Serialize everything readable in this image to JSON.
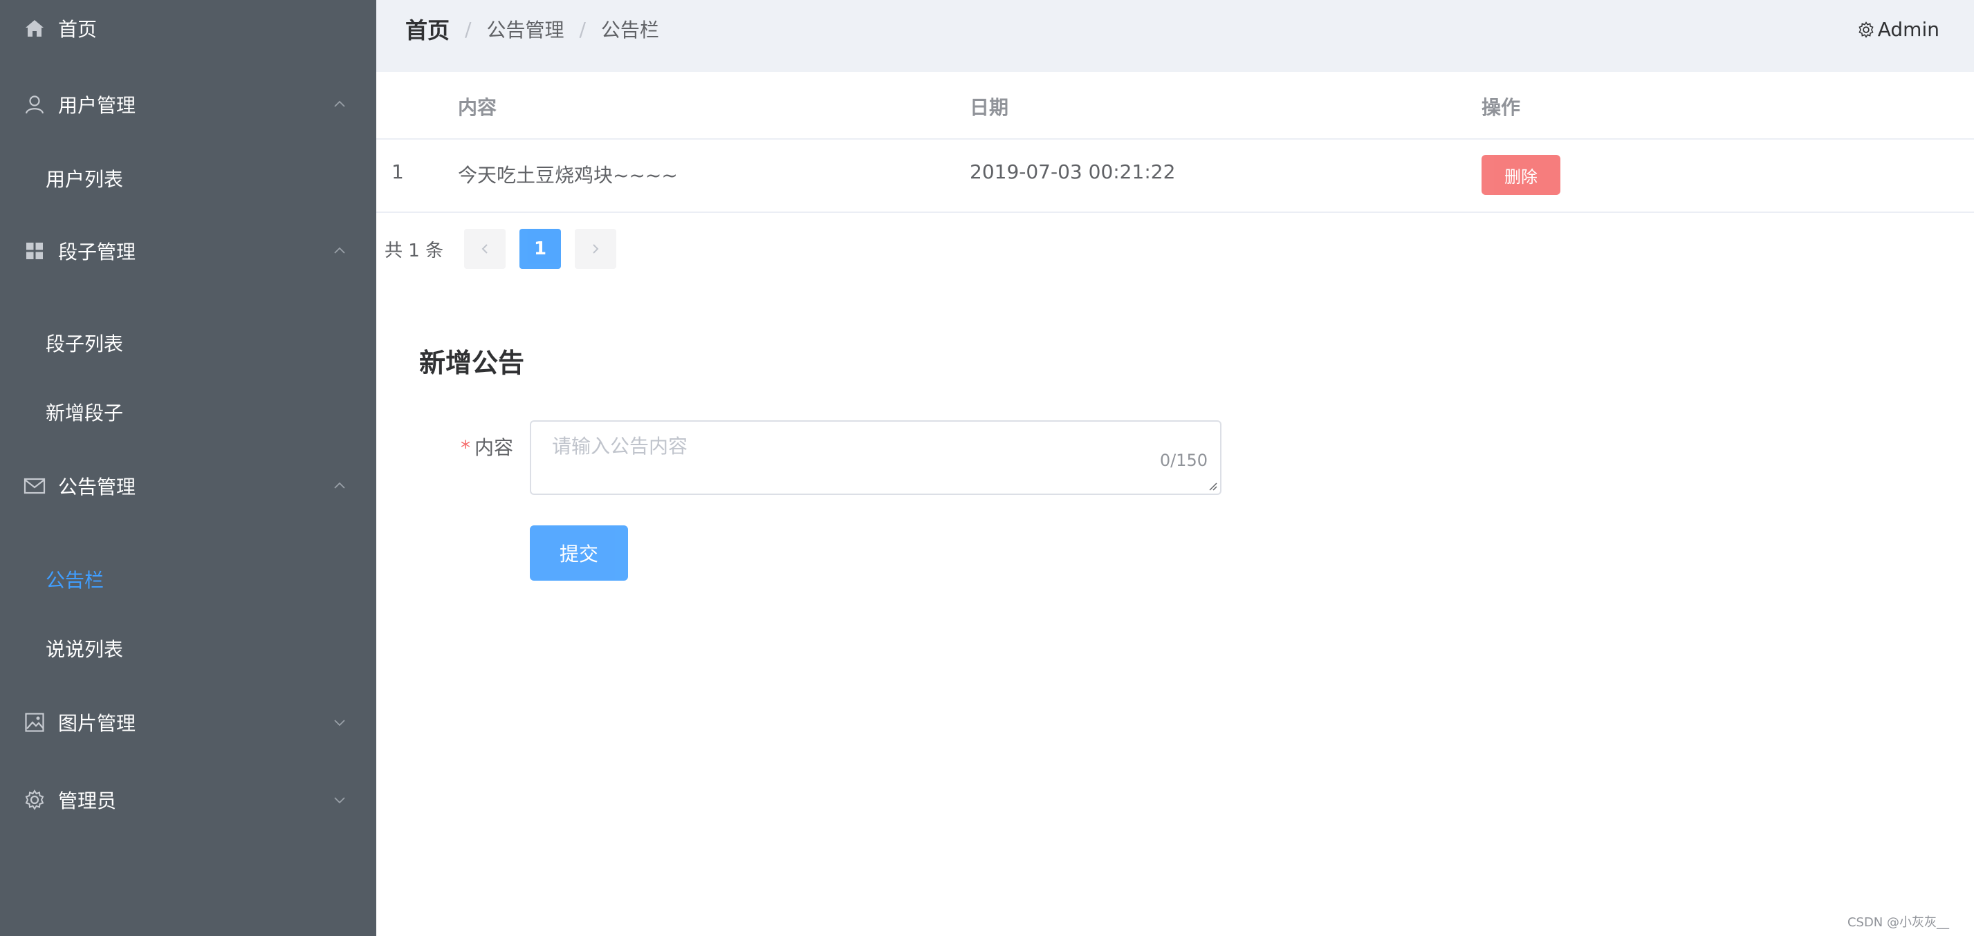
{
  "sidebar": {
    "items": [
      {
        "label": "首页",
        "icon": "home-icon"
      },
      {
        "label": "用户管理",
        "icon": "user-icon",
        "expanded": true
      },
      {
        "label": "段子管理",
        "icon": "grid-icon",
        "expanded": true
      },
      {
        "label": "公告管理",
        "icon": "mail-icon",
        "expanded": true
      },
      {
        "label": "图片管理",
        "icon": "picture-icon",
        "expanded": false
      },
      {
        "label": "管理员",
        "icon": "gear-icon",
        "expanded": false
      }
    ],
    "subitems": {
      "user_list": "用户列表",
      "joke_list": "段子列表",
      "add_joke": "新增段子",
      "notice_board": "公告栏",
      "talk_list": "说说列表"
    },
    "active": "公告栏",
    "active_color": "#409eff",
    "bg_color": "#545c64"
  },
  "header": {
    "breadcrumb": [
      "首页",
      "公告管理",
      "公告栏"
    ],
    "user": "Admin"
  },
  "table": {
    "columns": [
      "",
      "内容",
      "日期",
      "操作"
    ],
    "rows": [
      {
        "index": "1",
        "content": "今天吃土豆烧鸡块~~~~",
        "date": "2019-07-03 00:21:22",
        "action": "删除"
      }
    ]
  },
  "pagination": {
    "total_text": "共 1 条",
    "current_page": "1"
  },
  "form": {
    "title": "新增公告",
    "required_mark": "*",
    "content_label": "内容",
    "placeholder": "请输入公告内容",
    "value": "",
    "counter": "0/150",
    "submit_label": "提交"
  },
  "watermark": "CSDN @小灰灰__",
  "colors": {
    "primary": "#409eff",
    "danger": "#f56c6c",
    "header_bg": "#eef1f6"
  }
}
